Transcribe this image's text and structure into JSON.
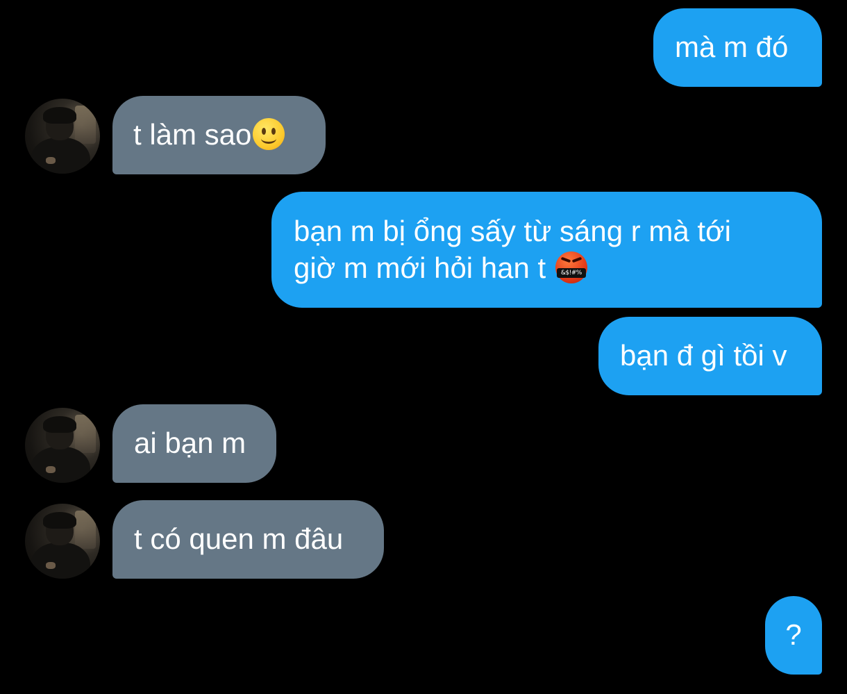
{
  "colors": {
    "background": "#000000",
    "outgoing_bubble": "#1da1f2",
    "incoming_bubble": "#657786",
    "text": "#ffffff"
  },
  "messages": [
    {
      "direction": "outgoing",
      "text": "mà m đó"
    },
    {
      "direction": "incoming",
      "text": "t làm sao",
      "emoji": "slightly-smiling-face-emoji"
    },
    {
      "direction": "outgoing",
      "lines": [
        "bạn m bị ổng sấy từ sáng r mà tới",
        "giờ m mới hỏi han t "
      ],
      "emoji": "face-with-symbols-on-mouth-emoji",
      "emoji_symbols": "&$!#%"
    },
    {
      "direction": "outgoing",
      "text": "bạn đ gì tồi v"
    },
    {
      "direction": "incoming",
      "text": "ai bạn m"
    },
    {
      "direction": "incoming",
      "text": "t có quen m đâu"
    },
    {
      "direction": "outgoing",
      "text": "?"
    }
  ]
}
